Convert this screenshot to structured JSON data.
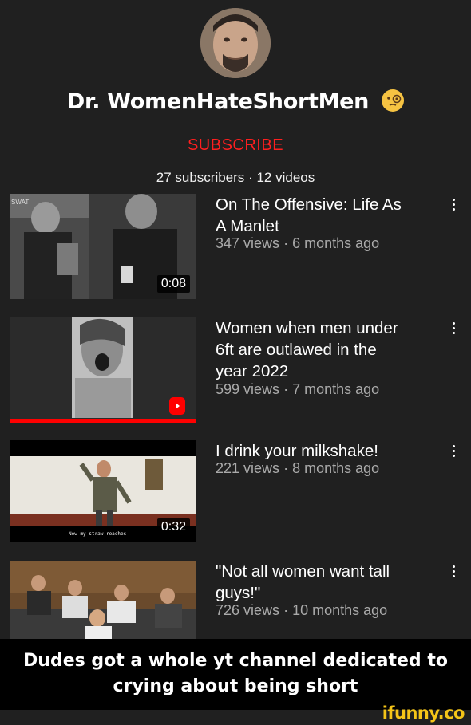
{
  "channel": {
    "name": "Dr. WomenHateShortMen",
    "subscribe_label": "SUBSCRIBE",
    "subscribers": "27 subscribers",
    "separator": "·",
    "videos_count": "12 videos"
  },
  "videos": [
    {
      "title_line1": "On The Offensive: Life As",
      "title_line2": "A Manlet",
      "views": "347 views",
      "age": "6 months ago",
      "duration": "0:08",
      "thumb_text": "SWAT"
    },
    {
      "title_line1": "Women when men under",
      "title_line2": "6ft are outlawed in the",
      "title_line3": "year 2022",
      "views": "599 views",
      "age": "7 months ago",
      "badge": "shorts-icon",
      "progress": 1.0
    },
    {
      "title_line1": "I drink your milkshake!",
      "views": "221 views",
      "age": "8 months ago",
      "duration": "0:32",
      "thumb_caption": "Now my straw reaches"
    },
    {
      "title_line1": "\"Not all women want tall",
      "title_line2": "guys!\"",
      "views": "726 views",
      "age": "10 months ago"
    }
  ],
  "caption": {
    "line1": "Dudes got a whole yt channel dedicated to",
    "line2": "crying about being short"
  },
  "watermark": "ifunny.co",
  "colors": {
    "background": "#202020",
    "subscribe": "#ff1f1f",
    "meta": "#aaaaaa",
    "progress": "#ff0000",
    "watermark": "#f5c518"
  }
}
